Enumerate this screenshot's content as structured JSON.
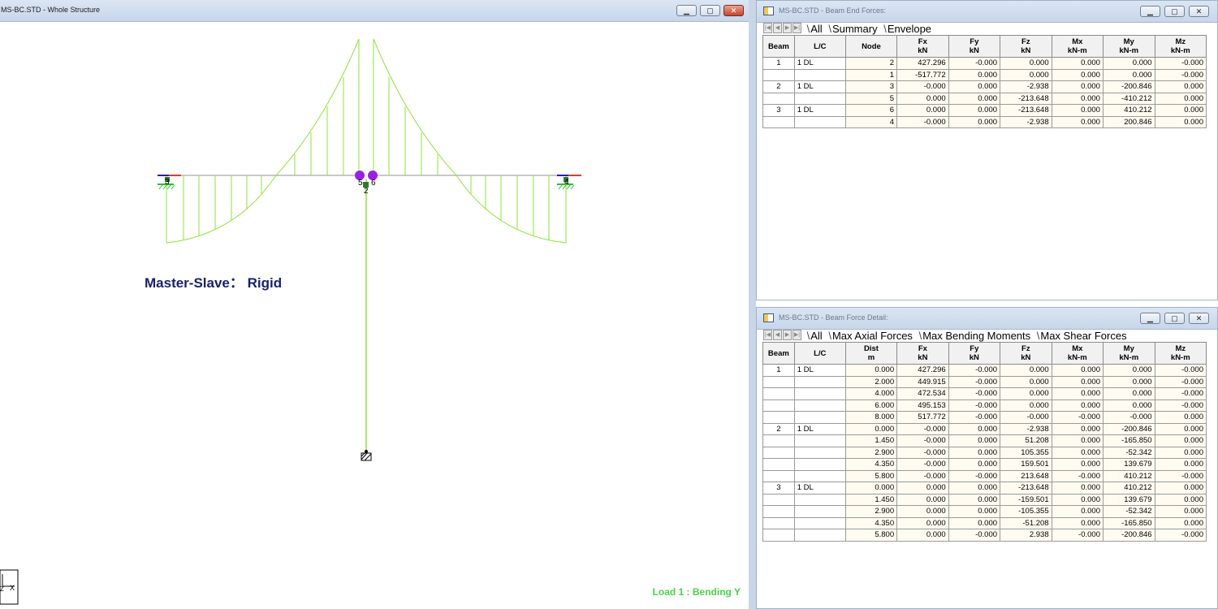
{
  "left_window": {
    "title": "MS-BC.STD - Whole Structure",
    "label": "Master-Slave： Rigid",
    "load_label": "Load 1 : Bending Y",
    "node_labels": [
      "3",
      "2",
      "5",
      "6",
      "4"
    ],
    "axis_labels": {
      "x": "X",
      "z": "Z"
    }
  },
  "beam_end_forces": {
    "title": "MS-BC.STD - Beam End Forces:",
    "tabs": [
      "All",
      "Summary",
      "Envelope"
    ],
    "headers": [
      [
        "Beam",
        ""
      ],
      [
        "L/C",
        ""
      ],
      [
        "Node",
        ""
      ],
      [
        "Fx",
        "kN"
      ],
      [
        "Fy",
        "kN"
      ],
      [
        "Fz",
        "kN"
      ],
      [
        "Mx",
        "kN-m"
      ],
      [
        "My",
        "kN-m"
      ],
      [
        "Mz",
        "kN-m"
      ]
    ],
    "rows": [
      [
        "1",
        "1 DL",
        "2",
        "427.296",
        "-0.000",
        "0.000",
        "0.000",
        "0.000",
        "-0.000"
      ],
      [
        "",
        "",
        "1",
        "-517.772",
        "0.000",
        "0.000",
        "0.000",
        "0.000",
        "-0.000"
      ],
      [
        "2",
        "1 DL",
        "3",
        "-0.000",
        "0.000",
        "-2.938",
        "0.000",
        "-200.846",
        "0.000"
      ],
      [
        "",
        "",
        "5",
        "0.000",
        "0.000",
        "-213.648",
        "0.000",
        "-410.212",
        "0.000"
      ],
      [
        "3",
        "1 DL",
        "6",
        "0.000",
        "0.000",
        "-213.648",
        "0.000",
        "410.212",
        "0.000"
      ],
      [
        "",
        "",
        "4",
        "-0.000",
        "0.000",
        "-2.938",
        "0.000",
        "200.846",
        "0.000"
      ]
    ]
  },
  "beam_force_detail": {
    "title": "MS-BC.STD - Beam Force Detail:",
    "tabs": [
      "All",
      "Max Axial Forces",
      "Max Bending Moments",
      "Max Shear Forces"
    ],
    "headers": [
      [
        "Beam",
        ""
      ],
      [
        "L/C",
        ""
      ],
      [
        "Dist",
        "m"
      ],
      [
        "Fx",
        "kN"
      ],
      [
        "Fy",
        "kN"
      ],
      [
        "Fz",
        "kN"
      ],
      [
        "Mx",
        "kN-m"
      ],
      [
        "My",
        "kN-m"
      ],
      [
        "Mz",
        "kN-m"
      ]
    ],
    "rows": [
      [
        "1",
        "1 DL",
        "0.000",
        "427.296",
        "-0.000",
        "0.000",
        "0.000",
        "0.000",
        "-0.000"
      ],
      [
        "",
        "",
        "2.000",
        "449.915",
        "-0.000",
        "0.000",
        "0.000",
        "0.000",
        "-0.000"
      ],
      [
        "",
        "",
        "4.000",
        "472.534",
        "-0.000",
        "0.000",
        "0.000",
        "0.000",
        "-0.000"
      ],
      [
        "",
        "",
        "6.000",
        "495.153",
        "-0.000",
        "0.000",
        "0.000",
        "0.000",
        "-0.000"
      ],
      [
        "",
        "",
        "8.000",
        "517.772",
        "-0.000",
        "-0.000",
        "-0.000",
        "-0.000",
        "0.000"
      ],
      [
        "2",
        "1 DL",
        "0.000",
        "-0.000",
        "0.000",
        "-2.938",
        "0.000",
        "-200.846",
        "0.000"
      ],
      [
        "",
        "",
        "1.450",
        "-0.000",
        "0.000",
        "51.208",
        "0.000",
        "-165.850",
        "0.000"
      ],
      [
        "",
        "",
        "2.900",
        "-0.000",
        "0.000",
        "105.355",
        "0.000",
        "-52.342",
        "0.000"
      ],
      [
        "",
        "",
        "4.350",
        "-0.000",
        "0.000",
        "159.501",
        "0.000",
        "139.679",
        "0.000"
      ],
      [
        "",
        "",
        "5.800",
        "-0.000",
        "-0.000",
        "213.648",
        "-0.000",
        "410.212",
        "-0.000"
      ],
      [
        "3",
        "1 DL",
        "0.000",
        "0.000",
        "0.000",
        "-213.648",
        "0.000",
        "410.212",
        "0.000"
      ],
      [
        "",
        "",
        "1.450",
        "0.000",
        "0.000",
        "-159.501",
        "0.000",
        "139.679",
        "0.000"
      ],
      [
        "",
        "",
        "2.900",
        "0.000",
        "0.000",
        "-105.355",
        "0.000",
        "-52.342",
        "0.000"
      ],
      [
        "",
        "",
        "4.350",
        "0.000",
        "0.000",
        "-51.208",
        "0.000",
        "-165.850",
        "0.000"
      ],
      [
        "",
        "",
        "5.800",
        "0.000",
        "-0.000",
        "2.938",
        "-0.000",
        "-200.846",
        "-0.000"
      ]
    ]
  },
  "colors": {
    "diagram": "#8fe33a",
    "node": "#9b1fe8",
    "label": "#1a1f6e",
    "load_label": "#47d447"
  }
}
